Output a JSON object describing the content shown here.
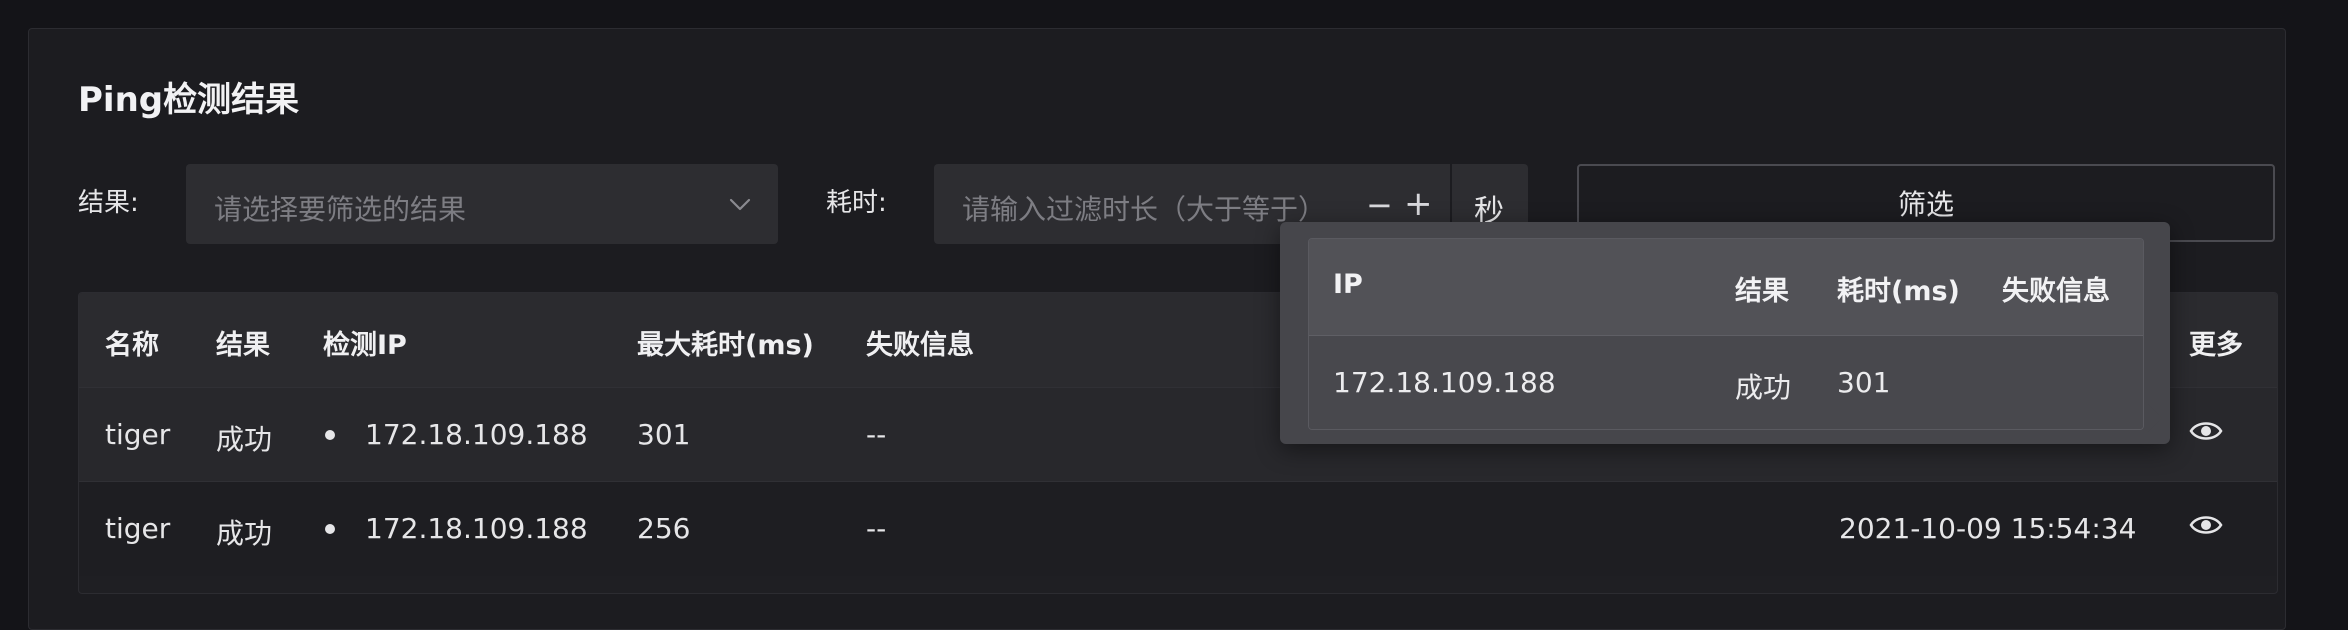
{
  "page": {
    "title": "Ping检测结果"
  },
  "filters": {
    "result_label": "结果:",
    "result_placeholder": "请选择要筛选的结果",
    "duration_label": "耗时:",
    "duration_placeholder": "请输入过滤时长（大于等于）",
    "minus": "−",
    "plus": "+",
    "unit": "秒",
    "filter_button": "筛选"
  },
  "table": {
    "columns": [
      "名称",
      "结果",
      "检测IP",
      "最大耗时(ms)",
      "失败信息",
      "更多"
    ],
    "rows": [
      {
        "name": "tiger",
        "result": "成功",
        "ip": "172.18.109.188",
        "max_ms": "301",
        "fail": "--",
        "time": ""
      },
      {
        "name": "tiger",
        "result": "成功",
        "ip": "172.18.109.188",
        "max_ms": "256",
        "fail": "--",
        "time": "2021-10-09 15:54:34"
      }
    ]
  },
  "popover": {
    "columns": [
      "IP",
      "结果",
      "耗时(ms)",
      "失败信息"
    ],
    "row": {
      "ip": "172.18.109.188",
      "result": "成功",
      "ms": "301",
      "fail": ""
    }
  },
  "icons": {
    "dropdown": "chevron-down-icon",
    "detail": "eye-icon"
  }
}
